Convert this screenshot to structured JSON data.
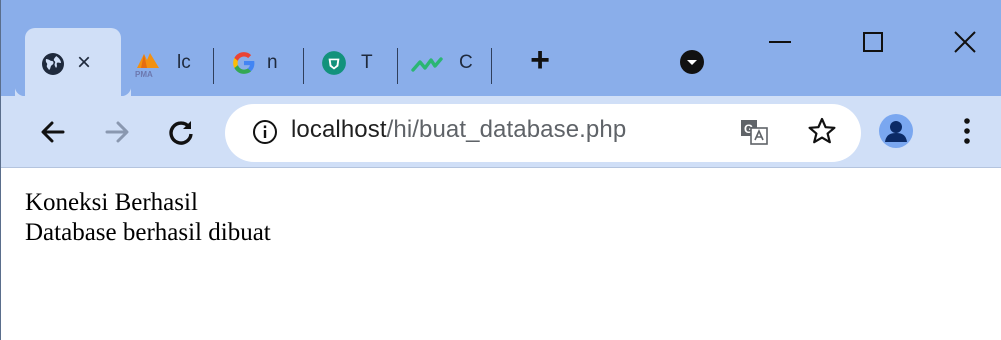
{
  "tabs": [
    {
      "title": "",
      "icon": "globe-icon",
      "active": true
    },
    {
      "title": "lc",
      "icon": "pma-logo-icon"
    },
    {
      "title": "n",
      "icon": "google-logo-icon"
    },
    {
      "title": "T",
      "icon": "shield-logo-icon"
    },
    {
      "title": "C",
      "icon": "chart-logo-icon"
    }
  ],
  "tab_close_label": "×",
  "new_tab_label": "+",
  "pma_logo_text": "PMA",
  "address_bar": {
    "host": "localhost",
    "path": "/hi/buat_database.php"
  },
  "page": {
    "line1": "Koneksi Berhasil",
    "line2": "Database berhasil dibuat"
  },
  "colors": {
    "tab_strip": "#8aaeea",
    "toolbar": "#d0dff7",
    "accent": "#1a73e8"
  }
}
